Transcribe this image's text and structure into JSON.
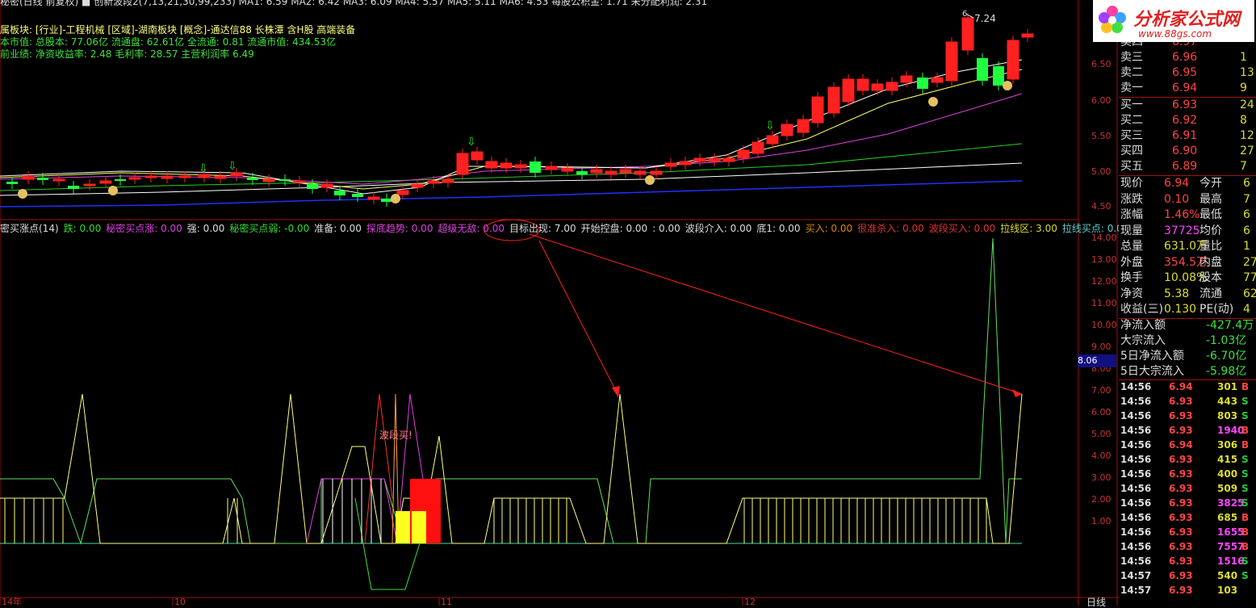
{
  "title_bar": {
    "text": "秘密(日线 前复权) ■ 创新波段2(7,13,21,30,99,233) MA1: 6.59 MA2: 6.42 MA3: 6.09 MA4: 5.57 MA5: 5.11 MA6: 4.53 每股公积金: 1.71 未分配利润: 2.31",
    "price_max_label": "7.24"
  },
  "stock_info": {
    "line1": "属板块: [行业]-工程机械 [区域]-湖南板块 [概念]-通达信88 长株潭 含H股 高端装备",
    "line2": "本市值: 总股本: 77.06亿 流通盘: 62.61亿 全流通: 0.81 流通市值: 434.53亿",
    "line3": "前业绩: 净资收益率: 2.48 毛利率: 28.57 主营利润率 6.49"
  },
  "price_axis": [
    "6.50",
    "6.00",
    "5.50",
    "5.00",
    "4.50"
  ],
  "indicator_axis": [
    "14.00",
    "13.00",
    "12.00",
    "11.00",
    "10.00",
    "9.00",
    "8.00",
    "7.00",
    "6.00",
    "5.00",
    "4.00",
    "3.00",
    "2.00",
    "1.00"
  ],
  "indicator_marker": "8.06",
  "indicator_bar": [
    {
      "text": "密买涨点(14)",
      "color": "#dddddd"
    },
    {
      "text": "跌: 0.00",
      "color": "#33dd33"
    },
    {
      "text": "秘密买点涨: 0.00",
      "color": "#dd44dd"
    },
    {
      "text": "强: 0.00",
      "color": "#dddddd"
    },
    {
      "text": "秘密买点弱: -0.00",
      "color": "#33dd33"
    },
    {
      "text": "准备: 0.00",
      "color": "#dddddd"
    },
    {
      "text": "探底趋势: 0.00",
      "color": "#dd44dd"
    },
    {
      "text": "超级无敌: 0.00",
      "color": "#dd44dd"
    },
    {
      "text": "目标出现: 7.00",
      "color": "#dddddd"
    },
    {
      "text": "开始控盘: 0.00",
      "color": "#dddddd"
    },
    {
      "text": ": 0.00",
      "color": "#dddddd"
    },
    {
      "text": "波段介入: 0.00",
      "color": "#dddddd"
    },
    {
      "text": "底1: 0.00",
      "color": "#dddddd"
    },
    {
      "text": "买入: 0.00",
      "color": "#dd8800"
    },
    {
      "text": "很准杀入: 0.00",
      "color": "#dd3333"
    },
    {
      "text": "波段买入: 0.00",
      "color": "#dd3333"
    },
    {
      "text": "拉线区: 3.00",
      "color": "#dddd33"
    },
    {
      "text": "拉线买点: 0.00",
      "color": "#66cccc"
    }
  ],
  "annotation_text": "波段买!",
  "time_axis": [
    "14年",
    "10",
    "11",
    "12"
  ],
  "period_label": "日线",
  "logo": {
    "name": "分析家公式网",
    "url": "www.88gs.com"
  },
  "quotes": {
    "sell": [
      {
        "label": "卖四",
        "price": "6.97",
        "vol": ""
      },
      {
        "label": "卖三",
        "price": "6.96",
        "vol": "1"
      },
      {
        "label": "卖二",
        "price": "6.95",
        "vol": "13"
      },
      {
        "label": "卖一",
        "price": "6.94",
        "vol": "9"
      }
    ],
    "buy": [
      {
        "label": "买一",
        "price": "6.93",
        "vol": "24"
      },
      {
        "label": "买二",
        "price": "6.92",
        "vol": "8"
      },
      {
        "label": "买三",
        "price": "6.91",
        "vol": "12"
      },
      {
        "label": "买四",
        "price": "6.90",
        "vol": "27"
      },
      {
        "label": "买五",
        "price": "6.89",
        "vol": "7"
      }
    ]
  },
  "stats": [
    {
      "k1": "现价",
      "v1": "6.94",
      "c1": "#ff4444",
      "k2": "今开",
      "v2": "6"
    },
    {
      "k1": "涨跌",
      "v1": "0.10",
      "c1": "#ff4444",
      "k2": "最高",
      "v2": "7"
    },
    {
      "k1": "涨幅",
      "v1": "1.46%",
      "c1": "#ff4444",
      "k2": "最低",
      "v2": "6"
    },
    {
      "k1": "现量",
      "v1": "37725",
      "c1": "#ff44ff",
      "k2": "均价",
      "v2": "6"
    },
    {
      "k1": "总量",
      "v1": "631.0万",
      "c1": "#dddd33",
      "k2": "量比",
      "v2": "1"
    },
    {
      "k1": "外盘",
      "v1": "354.5万",
      "c1": "#ff4444",
      "k2": "内盘",
      "v2": "276."
    },
    {
      "k1": "换手",
      "v1": "10.08%",
      "c1": "#dddd33",
      "k2": "股本",
      "v2": "77."
    },
    {
      "k1": "净资",
      "v1": "5.38",
      "c1": "#dddd33",
      "k2": "流通",
      "v2": "62."
    },
    {
      "k1": "收益(三)",
      "v1": "0.130",
      "c1": "#dddd33",
      "k2": "PE(动)",
      "v2": "4"
    }
  ],
  "flows": [
    {
      "k": "净流入额",
      "v": "-427.4万"
    },
    {
      "k": "大宗流入",
      "v": "-1.03亿"
    },
    {
      "k": "5日净流入额",
      "v": "-6.70亿"
    },
    {
      "k": "5日大宗流入",
      "v": "-5.98亿"
    }
  ],
  "ticks": [
    {
      "time": "14:56",
      "price": "6.94",
      "vol": "301",
      "bs": "B"
    },
    {
      "time": "14:56",
      "price": "6.93",
      "vol": "443",
      "bs": "S"
    },
    {
      "time": "14:56",
      "price": "6.93",
      "vol": "803",
      "bs": "S"
    },
    {
      "time": "14:56",
      "price": "6.93",
      "vol": "1940",
      "bs": "B"
    },
    {
      "time": "14:56",
      "price": "6.94",
      "vol": "306",
      "bs": "B"
    },
    {
      "time": "14:56",
      "price": "6.93",
      "vol": "415",
      "bs": "S"
    },
    {
      "time": "14:56",
      "price": "6.93",
      "vol": "400",
      "bs": "S"
    },
    {
      "time": "14:56",
      "price": "6.93",
      "vol": "509",
      "bs": "S"
    },
    {
      "time": "14:56",
      "price": "6.93",
      "vol": "3825",
      "bs": "S"
    },
    {
      "time": "14:56",
      "price": "6.93",
      "vol": "685",
      "bs": "B"
    },
    {
      "time": "14:56",
      "price": "6.93",
      "vol": "1655",
      "bs": "B"
    },
    {
      "time": "14:56",
      "price": "6.93",
      "vol": "7557",
      "bs": "B"
    },
    {
      "time": "14:56",
      "price": "6.93",
      "vol": "1516",
      "bs": "S"
    },
    {
      "time": "14:57",
      "price": "6.93",
      "vol": "540",
      "bs": "S"
    },
    {
      "time": "14:57",
      "price": "6.93",
      "vol": "103",
      "bs": ""
    }
  ],
  "colors": {
    "up": "#ff2020",
    "down": "#20ff40",
    "buy": "#ff4040",
    "sell": "#20cc40"
  }
}
